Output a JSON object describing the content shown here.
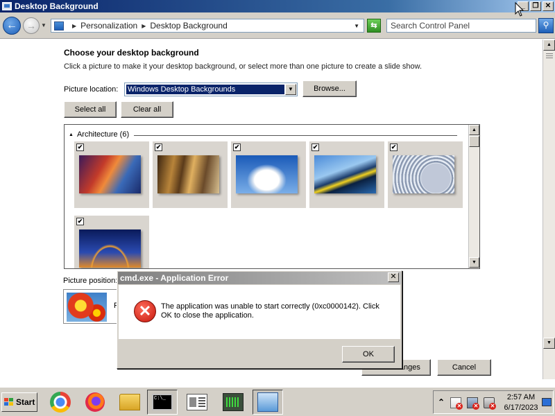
{
  "window": {
    "title": "Desktop Background",
    "minimize": "_",
    "restore": "❐",
    "close": "✕"
  },
  "address": {
    "breadcrumb": [
      "Personalization",
      "Desktop Background"
    ],
    "search_placeholder": "Search Control Panel"
  },
  "page": {
    "heading": "Choose your desktop background",
    "description": "Click a picture to make it your desktop background, or select more than one picture to create a slide show.",
    "location_label": "Picture location:",
    "location_value": "Windows Desktop Backgrounds",
    "browse_label": "Browse...",
    "select_all_label": "Select all",
    "clear_all_label": "Clear all",
    "group_label": "Architecture (6)",
    "group_toggle": "▲",
    "checkmark": "✔",
    "position_label": "Picture position:",
    "position_value": "F",
    "save_label": "Save changes",
    "cancel_label": "Cancel",
    "thumbnails": [
      {
        "name": "architecture-1",
        "checked": true
      },
      {
        "name": "architecture-2",
        "checked": true
      },
      {
        "name": "architecture-3",
        "checked": true
      },
      {
        "name": "architecture-4",
        "checked": true
      },
      {
        "name": "architecture-5",
        "checked": true
      },
      {
        "name": "architecture-6",
        "checked": true
      }
    ]
  },
  "dialog": {
    "title": "cmd.exe - Application Error",
    "message": "The application was unable to start correctly (0xc0000142). Click OK to close the application.",
    "ok_label": "OK",
    "close": "✕",
    "icon": "error-icon"
  },
  "taskbar": {
    "start_label": "Start",
    "apps": [
      "chrome-icon",
      "firefox-icon",
      "file-explorer-icon",
      "command-prompt-icon",
      "document-viewer-icon",
      "task-manager-icon",
      "control-panel-icon"
    ],
    "tray_expand": "⌃",
    "time": "2:57 AM",
    "date": "6/17/2023"
  },
  "colors": {
    "title_active": "#0a246a",
    "title_inactive": "#808080",
    "face": "#d4d0c8",
    "selection": "#0a246a",
    "error_red": "#c4160b"
  }
}
